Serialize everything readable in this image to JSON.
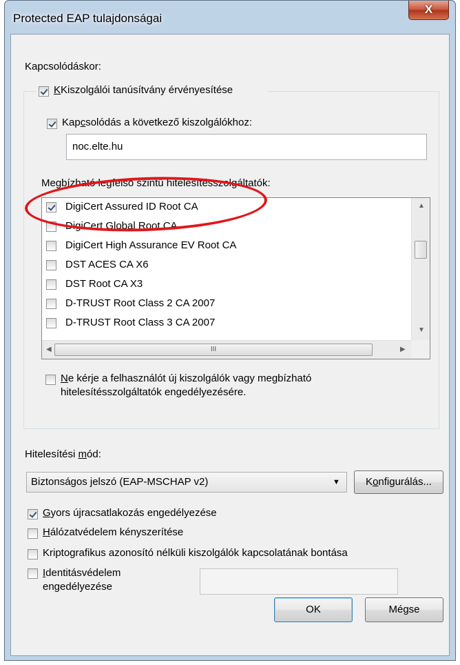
{
  "window": {
    "title": "Protected EAP tulajdonságai",
    "close_label": "X"
  },
  "connect": {
    "heading": "Kapcsolódáskor:",
    "validate_cert": {
      "label": "Kiszolgálói tanúsítvány érvényesítése",
      "checked": true
    },
    "connect_servers": {
      "label_pre": "Kap",
      "label_u": "c",
      "label_post": "solódás a következő kiszolgálókhoz:",
      "checked": true
    },
    "server_value": "noc.elte.hu",
    "trusted_ca_label": "Megbízható legfelső szintű hitelesítésszolgáltatók:",
    "ca_list": [
      {
        "name": "DigiCert Assured ID Root CA",
        "checked": true
      },
      {
        "name": "DigiCert Global Root CA",
        "checked": false
      },
      {
        "name": "DigiCert High Assurance EV Root CA",
        "checked": false
      },
      {
        "name": "DST ACES CA X6",
        "checked": false
      },
      {
        "name": "DST Root CA X3",
        "checked": false
      },
      {
        "name": "D-TRUST Root Class 2 CA 2007",
        "checked": false
      },
      {
        "name": "D-TRUST Root Class 3 CA 2007",
        "checked": false
      }
    ],
    "hscroll_grip": "III",
    "no_prompt": {
      "line1_u": "N",
      "line1": "e kérje a felhasználót új kiszolgálók vagy megbízható",
      "line2": "hitelesítésszolgáltatók engedélyezésére.",
      "checked": false
    }
  },
  "auth": {
    "label_pre": "Hitelesítési ",
    "label_u": "m",
    "label_post": "ód:",
    "selected": "Biztonságos jelszó (EAP-MSCHAP v2)",
    "configure_u": "o",
    "configure_pre": "K",
    "configure_post": "nfigurálás..."
  },
  "options": {
    "fast_reconnect": {
      "u": "G",
      "label": "yors újracsatlakozás engedélyezése",
      "checked": true
    },
    "nap": {
      "u": "H",
      "label": "álózatvédelem kényszerítése",
      "checked": false
    },
    "crypto": {
      "label": "Kriptografikus azonosító nélküli kiszolgálók kapcsolatának bontása",
      "checked": false
    },
    "identity": {
      "u": "I",
      "line1": "dentitásvédelem",
      "line2": "engedélyezése",
      "checked": false,
      "value": ""
    }
  },
  "buttons": {
    "ok": "OK",
    "cancel": "Mégse"
  },
  "colors": {
    "annotation": "#e0171b",
    "close": "#c4533a"
  }
}
